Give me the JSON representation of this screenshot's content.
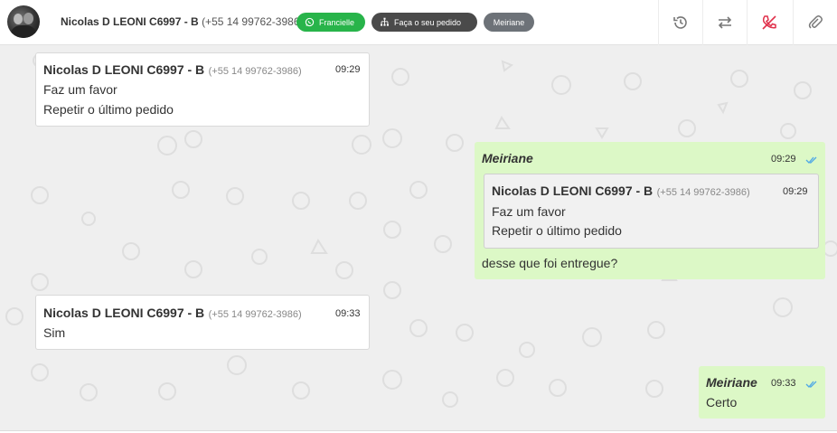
{
  "header": {
    "contact_name": "Nicolas D LEONI C6997 - B",
    "contact_phone": "(+55 14 99762-3986)",
    "tags": [
      {
        "label": "Francielle",
        "color": "#28b44a",
        "icon": "whatsapp-icon"
      },
      {
        "label": "Faça o seu pedido",
        "color": "#4a4a4a",
        "icon": "sitemap-icon"
      },
      {
        "label": "Meiriane",
        "color": "#6d7278"
      }
    ],
    "actions": [
      {
        "icon": "history-icon"
      },
      {
        "icon": "transfer-arrows-icon"
      },
      {
        "icon": "end-call-icon",
        "color": "#e0314b"
      },
      {
        "icon": "paperclip-icon"
      }
    ]
  },
  "messages": [
    {
      "direction": "in",
      "sender": "Nicolas D LEONI C6997 - B",
      "phone": "(+55 14 99762-3986)",
      "time": "09:29",
      "lines": [
        "Faz um favor",
        "Repetir o último pedido"
      ]
    },
    {
      "direction": "out",
      "sender": "Meiriane",
      "time": "09:29",
      "quote": {
        "sender": "Nicolas D LEONI C6997 - B",
        "phone": "(+55 14 99762-3986)",
        "time": "09:29",
        "lines": [
          "Faz um favor",
          "Repetir o último pedido"
        ]
      },
      "lines": [
        "desse que foi entregue?"
      ]
    },
    {
      "direction": "in",
      "sender": "Nicolas D LEONI C6997 - B",
      "phone": "(+55 14 99762-3986)",
      "time": "09:33",
      "lines": [
        "Sim"
      ]
    },
    {
      "direction": "out",
      "sender": "Meiriane",
      "time": "09:33",
      "lines": [
        "Certo"
      ]
    }
  ],
  "colors": {
    "incoming_bubble": "#ffffff",
    "outgoing_bubble": "#dcf8c6",
    "read_ticks": "#4fa8e6",
    "chat_background": "#efefef"
  }
}
